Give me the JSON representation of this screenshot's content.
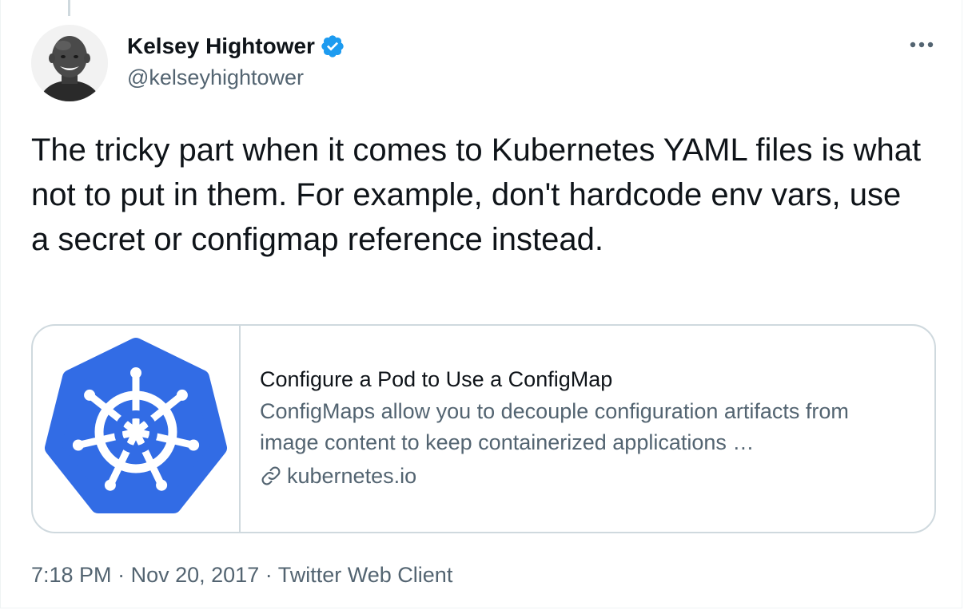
{
  "author": {
    "display_name": "Kelsey Hightower",
    "handle": "@kelseyhightower",
    "verified": true,
    "avatar_icon": "profile-photo"
  },
  "tweet": {
    "text": "The tricky part when it comes to Kubernetes YAML files is what not to put in them. For example, don't hardcode env vars, use a secret or configmap reference instead."
  },
  "card": {
    "image_icon": "kubernetes-logo",
    "title": "Configure a Pod to Use a ConfigMap",
    "description": "ConfigMaps allow you to decouple configuration artifacts from image content to keep containerized applications …",
    "domain": "kubernetes.io",
    "domain_icon": "link-icon"
  },
  "meta": {
    "time": "7:18 PM",
    "separator": "·",
    "date": "Nov 20, 2017",
    "client": "Twitter Web Client"
  },
  "colors": {
    "text_primary": "#0f1419",
    "text_secondary": "#536471",
    "verified_blue": "#1d9bf0",
    "kubernetes_blue": "#326ce5",
    "border": "#cfd9de"
  }
}
